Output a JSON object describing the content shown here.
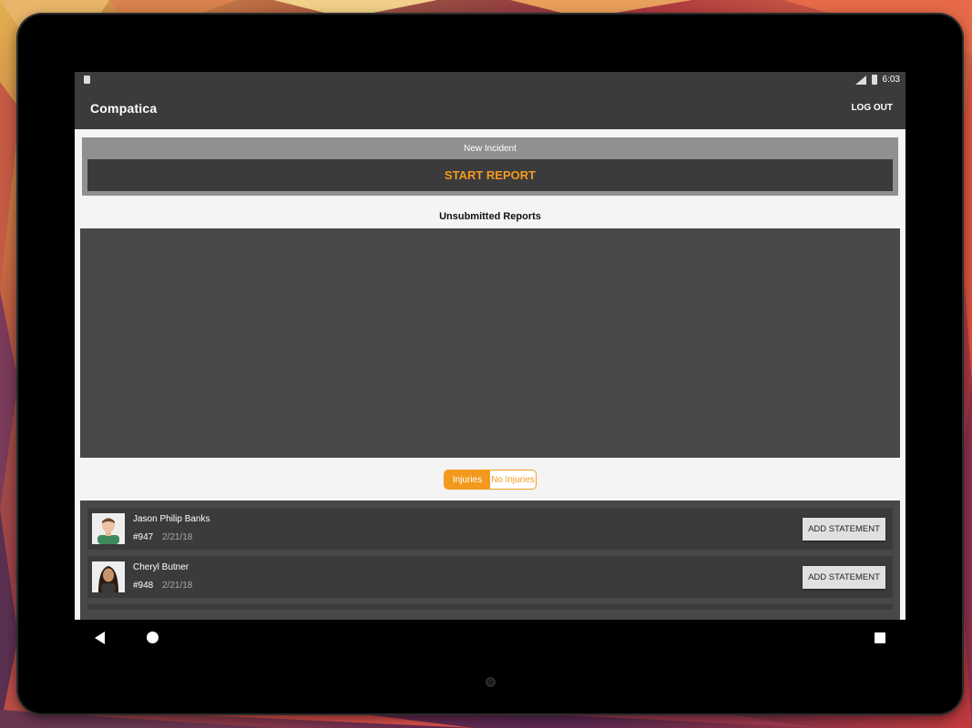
{
  "status_bar": {
    "time": "6:03",
    "sd_icon": "sd-card-icon",
    "signal_icon": "signal-icon",
    "battery_icon": "battery-icon"
  },
  "toolbar": {
    "title": "Compatica",
    "logout_label": "LOG OUT"
  },
  "new_incident": {
    "label": "New Incident",
    "start_label": "START REPORT"
  },
  "unsubmitted": {
    "title": "Unsubmitted Reports"
  },
  "filter": {
    "options": [
      "Injuries",
      "No Injuries"
    ],
    "selected": "Injuries"
  },
  "reports": [
    {
      "name": "Jason Philip Banks",
      "number": "#947",
      "date": "2/21/18",
      "action": "ADD STATEMENT"
    },
    {
      "name": "Cheryl Butner",
      "number": "#948",
      "date": "2/21/18",
      "action": "ADD STATEMENT"
    }
  ],
  "colors": {
    "accent": "#f39a1e",
    "toolbar": "#3b3b3d",
    "panel": "#484848"
  },
  "nav": {
    "back_icon": "back-icon",
    "home_icon": "home-icon",
    "recents_icon": "recents-icon"
  }
}
